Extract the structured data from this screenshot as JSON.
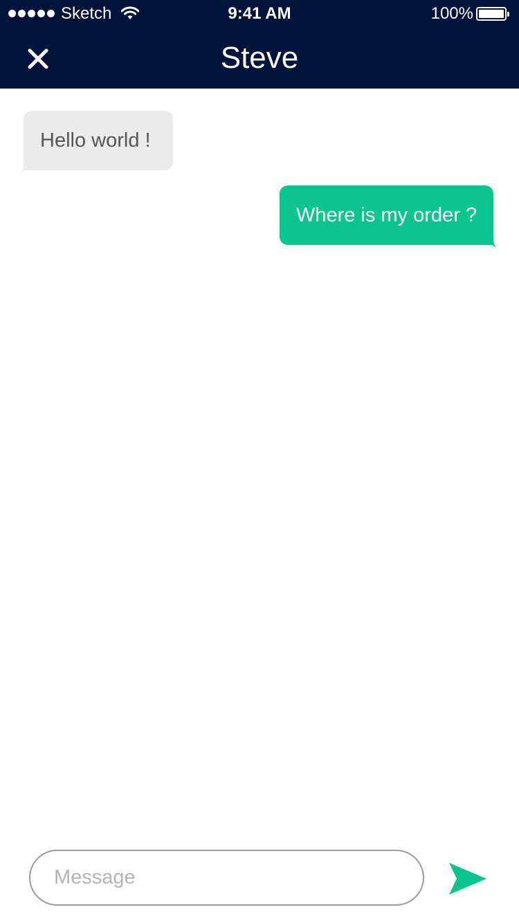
{
  "status_bar": {
    "carrier": "Sketch",
    "time": "9:41 AM",
    "battery": "100%",
    "signal_icon": "signal-dots-icon",
    "wifi_icon": "wifi-icon",
    "battery_icon": "battery-full-icon"
  },
  "header": {
    "title": "Steve",
    "close_icon": "close-icon",
    "background": "#00133a"
  },
  "messages": [
    {
      "direction": "incoming",
      "text": "Hello world !",
      "color": "#ebebeb"
    },
    {
      "direction": "outgoing",
      "text": "Where is my order ?",
      "color": "#0bc68c"
    }
  ],
  "composer": {
    "placeholder": "Message",
    "value": "",
    "send_icon": "send-icon",
    "accent": "#0bc68c"
  }
}
